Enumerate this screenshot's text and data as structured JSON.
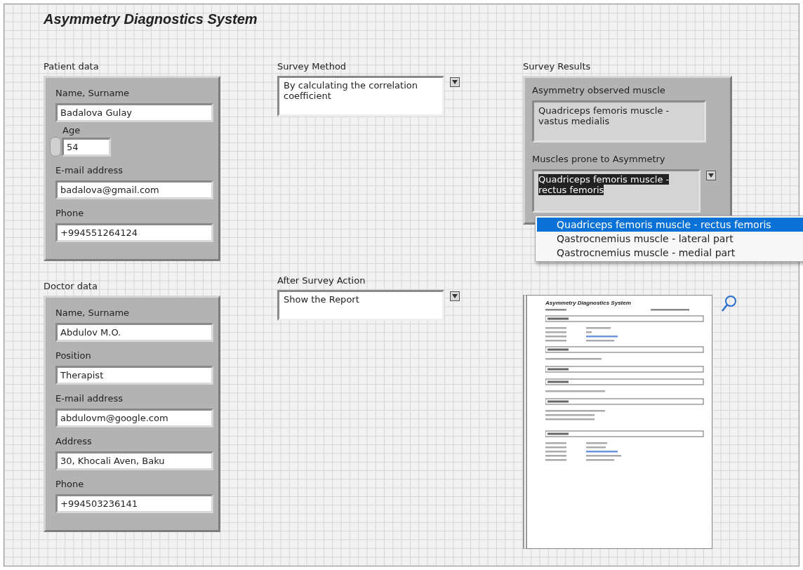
{
  "window": {
    "title": "Asymmetry Diagnostics System"
  },
  "patient": {
    "label": "Patient data",
    "fields": [
      {
        "kind": "text",
        "label": "Name, Surname",
        "value": "Badalova Gulay"
      },
      {
        "kind": "numeric",
        "label": "Age",
        "value": "54"
      },
      {
        "kind": "text",
        "label": "E-mail address",
        "value": "badalova@gmail.com"
      },
      {
        "kind": "text",
        "label": "Phone",
        "value": "+994551264124"
      }
    ]
  },
  "doctor": {
    "label": "Doctor data",
    "fields": [
      {
        "kind": "text",
        "label": "Name, Surname",
        "value": "Abdulov M.O."
      },
      {
        "kind": "text",
        "label": "Position",
        "value": "Therapist"
      },
      {
        "kind": "text",
        "label": "E-mail address",
        "value": "abdulovm@google.com"
      },
      {
        "kind": "text",
        "label": "Address",
        "value": "30, Khocali Aven, Baku"
      },
      {
        "kind": "text",
        "label": "Phone",
        "value": "+994503236141"
      }
    ]
  },
  "survey_method": {
    "label": "Survey Method",
    "value": "By calculating the correlation coefficient"
  },
  "after_survey_action": {
    "label": "After Survey Action",
    "value": "Show the Report"
  },
  "survey_results": {
    "label": "Survey Results",
    "observed": {
      "label": "Asymmetry observed muscle",
      "value": "Quadriceps femoris muscle - vastus medialis"
    },
    "prone": {
      "label": "Muscles prone to Asymmetry",
      "value": "Quadriceps femoris muscle - rectus femoris",
      "options": [
        {
          "text": "Quadriceps femoris muscle - rectus femoris",
          "selected": true
        },
        {
          "text": "Qastrocnemius muscle - lateral part",
          "selected": false
        },
        {
          "text": "Qastrocnemius muscle - medial part",
          "selected": false
        }
      ]
    }
  },
  "report_preview": {
    "title": "Asymmetry Diagnostics System"
  }
}
